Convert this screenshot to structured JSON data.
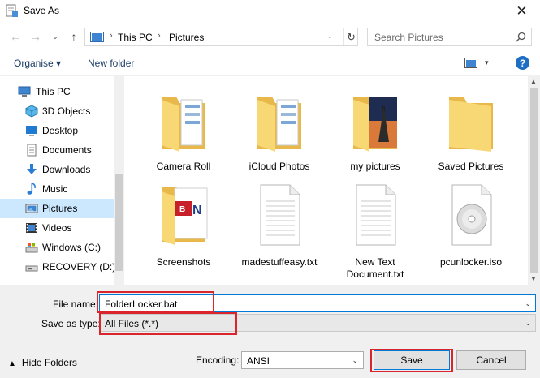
{
  "window": {
    "title": "Save As",
    "close_glyph": "✕"
  },
  "nav": {
    "back_glyph": "←",
    "forward_glyph": "→",
    "recent_glyph": "⌄",
    "up_glyph": "↑",
    "breadcrumb": [
      "This PC",
      "Pictures"
    ],
    "breadcrumb_sep": "›",
    "address_dropdown_glyph": "⌄",
    "refresh_glyph": "↻",
    "search_placeholder": "Search Pictures"
  },
  "toolbar": {
    "organise_label": "Organise ▾",
    "new_folder_label": "New folder",
    "view_caret": "▾",
    "help_label": "?"
  },
  "sidebar": {
    "items": [
      {
        "label": "This PC",
        "icon": "computer-icon",
        "selected": false
      },
      {
        "label": "3D Objects",
        "icon": "cube-icon",
        "selected": false
      },
      {
        "label": "Desktop",
        "icon": "desktop-icon",
        "selected": false
      },
      {
        "label": "Documents",
        "icon": "document-icon",
        "selected": false
      },
      {
        "label": "Downloads",
        "icon": "download-icon",
        "selected": false
      },
      {
        "label": "Music",
        "icon": "music-icon",
        "selected": false
      },
      {
        "label": "Pictures",
        "icon": "pictures-icon",
        "selected": true
      },
      {
        "label": "Videos",
        "icon": "video-icon",
        "selected": false
      },
      {
        "label": "Windows (C:)",
        "icon": "drive-icon",
        "selected": false
      },
      {
        "label": "RECOVERY (D:)",
        "icon": "drive-icon",
        "selected": false
      }
    ]
  },
  "files": [
    {
      "name": "Camera Roll",
      "icon": "folder-icon"
    },
    {
      "name": "iCloud Photos",
      "icon": "folder-icon"
    },
    {
      "name": "my pictures",
      "icon": "folder-photo-icon"
    },
    {
      "name": "Saved Pictures",
      "icon": "folder-icon"
    },
    {
      "name": "Screenshots",
      "icon": "folder-screenshot-icon"
    },
    {
      "name": "madestuffeasy.txt",
      "icon": "text-file-icon"
    },
    {
      "name": "New Text Document.txt",
      "icon": "text-file-icon"
    },
    {
      "name": "pcunlocker.iso",
      "icon": "disc-image-icon"
    }
  ],
  "form": {
    "file_name_label": "File name:",
    "file_name_value": "FolderLocker.bat",
    "save_as_type_label": "Save as type:",
    "save_as_type_value": "All Files  (*.*)",
    "dropdown_glyph": "⌄",
    "encoding_label": "Encoding:",
    "encoding_value": "ANSI",
    "hide_folders_label": "Hide Folders",
    "hide_folders_glyph": "▲",
    "save_label": "Save",
    "cancel_label": "Cancel"
  },
  "colors": {
    "accent": "#0078d7",
    "highlight_red": "#d9252b",
    "selected_bg": "#cce8ff",
    "folder": "#f8d775"
  }
}
